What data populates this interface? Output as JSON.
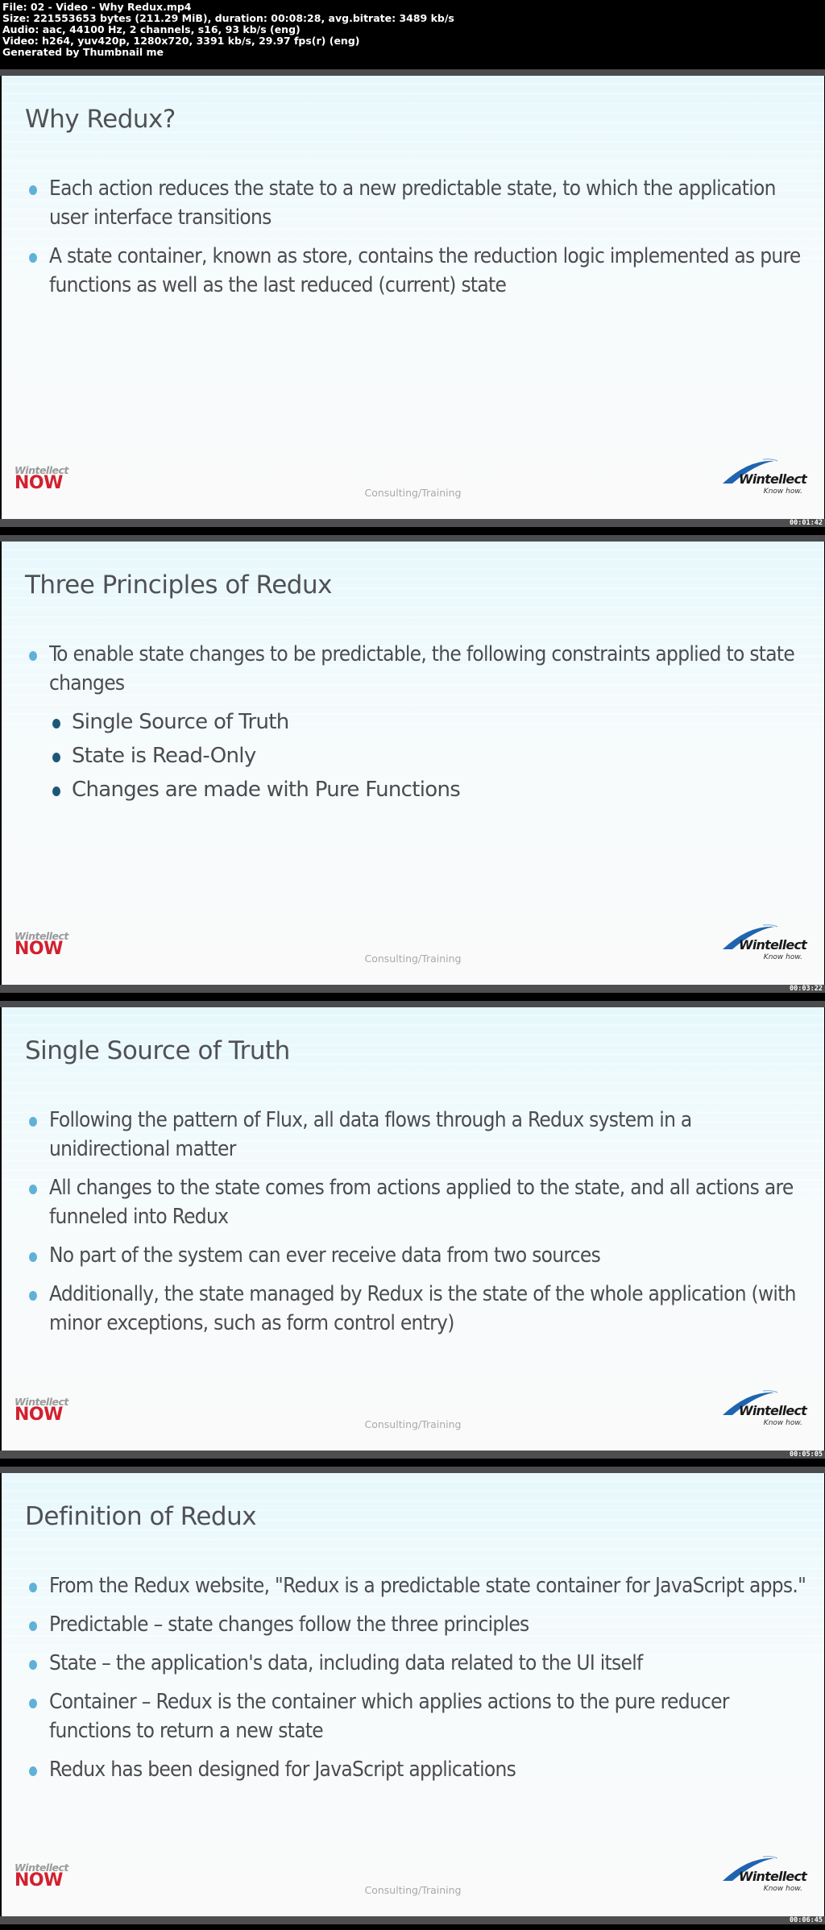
{
  "info_header": {
    "lines": [
      "File: 02 - Video - Why Redux.mp4",
      "Size: 221553653 bytes (211.29 MiB), duration: 00:08:28, avg.bitrate: 3489 kb/s",
      "Audio: aac, 44100 Hz, 2 channels, s16, 93 kb/s (eng)",
      "Video: h264, yuv420p, 1280x720, 3391 kb/s, 29.97 fps(r) (eng)",
      "Generated by Thumbnail me"
    ]
  },
  "branding": {
    "left_logo_top": "Wintellect",
    "left_logo_bottom": "NOW",
    "footer_text": "Consulting/Training",
    "right_logo_brand": "Wintellect",
    "right_logo_tagline": "Know how.",
    "colors": {
      "now_red": "#d2202f",
      "bullet_blue": "#5fb1d9",
      "sub_bullet_navy": "#1d5777",
      "text_gray": "#4b4c50"
    }
  },
  "frames": [
    {
      "timestamp": "00:01:42",
      "title": "Why Redux?",
      "bullets": [
        {
          "text": "Each action reduces the state to a new predictable state, to which the application user interface transitions",
          "level": 1
        },
        {
          "text": "A state container, known as store, contains the reduction logic implemented as pure functions as well as the last reduced (current) state",
          "level": 1
        }
      ]
    },
    {
      "timestamp": "00:03:22",
      "title": "Three Principles of Redux",
      "bullets": [
        {
          "text": "To enable state changes to be predictable, the following constraints applied to state changes",
          "level": 1
        },
        {
          "text": "Single Source of Truth",
          "level": 2
        },
        {
          "text": "State is Read-Only",
          "level": 2
        },
        {
          "text": "Changes are made with Pure Functions",
          "level": 2
        }
      ]
    },
    {
      "timestamp": "00:05:05",
      "title": "Single Source of Truth",
      "bullets": [
        {
          "text": "Following the pattern of Flux, all data flows through a Redux system in a unidirectional matter",
          "level": 1
        },
        {
          "text": "All changes to the state comes from actions applied to the state, and all actions are funneled into Redux",
          "level": 1
        },
        {
          "text": "No part of the system can ever receive data from two sources",
          "level": 1
        },
        {
          "text": "Additionally, the state managed by Redux is the state of the whole application (with minor exceptions, such as form control entry)",
          "level": 1
        }
      ]
    },
    {
      "timestamp": "00:06:45",
      "title": "Definition of Redux",
      "bullets": [
        {
          "text": "From the Redux website, \"Redux is a predictable state container for JavaScript apps.\"",
          "level": 1
        },
        {
          "text": "Predictable – state changes follow the three principles",
          "level": 1
        },
        {
          "text": "State – the application's data, including data related to the UI itself",
          "level": 1
        },
        {
          "text": "Container – Redux is the container which applies actions to the pure reducer functions to return a new state",
          "level": 1
        },
        {
          "text": "Redux has been designed for JavaScript applications",
          "level": 1
        }
      ]
    }
  ]
}
